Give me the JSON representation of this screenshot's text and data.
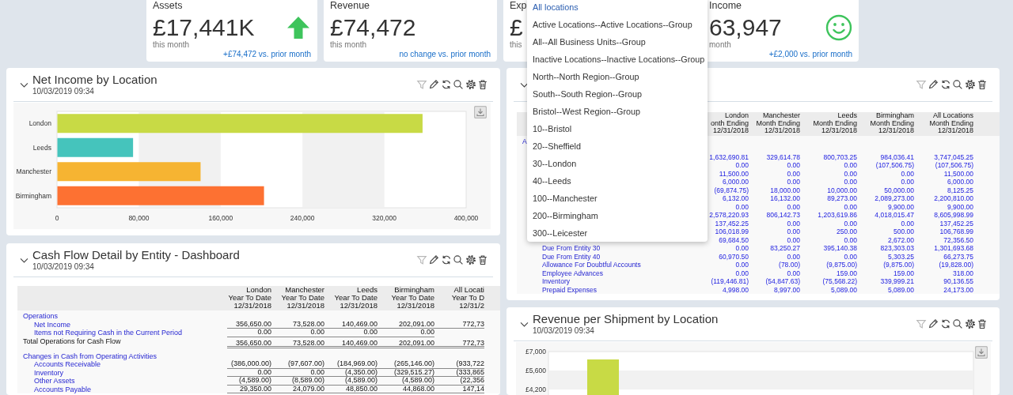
{
  "kpis": [
    {
      "title": "Assets",
      "value": "£17,441K",
      "caption": "this month",
      "change": "+£74,472 vs. prior month",
      "kind": "arrow"
    },
    {
      "title": "Revenue",
      "value": "£74,472",
      "caption": "this month",
      "change": "no change vs. prior month",
      "kind": "plain"
    },
    {
      "title": "Exp",
      "value": "£",
      "caption": "this",
      "kind": "plain"
    },
    {
      "title": "Income",
      "value": "63,947",
      "caption": "month",
      "change": "+£2,000 vs. prior month",
      "kind": "smiley"
    }
  ],
  "location_menu": {
    "items": [
      {
        "label": "All locations",
        "selected": true
      },
      {
        "label": "Active Locations--Active Locations--Group",
        "selected": false
      },
      {
        "label": "All--All Business Units--Group",
        "selected": false
      },
      {
        "label": "Inactive Locations--Inactive Locations--Group",
        "selected": false
      },
      {
        "label": "North--North Region--Group",
        "selected": false
      },
      {
        "label": "South--South Region--Group",
        "selected": false
      },
      {
        "label": "Bristol--West Region--Group",
        "selected": false
      },
      {
        "label": "10--Bristol",
        "selected": false
      },
      {
        "label": "20--Sheffield",
        "selected": false
      },
      {
        "label": "30--London",
        "selected": false
      },
      {
        "label": "40--Leeds",
        "selected": false
      },
      {
        "label": "100--Manchester",
        "selected": false
      },
      {
        "label": "200--Birmingham",
        "selected": false
      },
      {
        "label": "300--Leicester",
        "selected": false
      }
    ]
  },
  "net_income_panel": {
    "title": "Net Income by Location",
    "timestamp": "10/03/2019 09:34",
    "chart_data": {
      "type": "bar",
      "orientation": "horizontal",
      "categories": [
        "London",
        "Leeds",
        "Manchester",
        "Birmingham"
      ],
      "values": [
        357000,
        74000,
        140000,
        202000
      ],
      "colors": [
        "#c8da45",
        "#45c4bc",
        "#f6b432",
        "#fd7132"
      ],
      "xlim": [
        0,
        400000
      ],
      "xticks": [
        {
          "value": 0,
          "label": "0"
        },
        {
          "value": 80000,
          "label": "80,000"
        },
        {
          "value": 160000,
          "label": "160,000"
        },
        {
          "value": 240000,
          "label": "240,000"
        },
        {
          "value": 320000,
          "label": "320,000"
        },
        {
          "value": 400000,
          "label": "400,000"
        }
      ]
    }
  },
  "cash_flow_panel": {
    "title": "Cash Flow Detail by Entity - Dashboard",
    "timestamp": "10/03/2019 09:34",
    "columns": [
      {
        "name": "London",
        "period": "Year To Date",
        "date": "12/31/2018"
      },
      {
        "name": "Manchester",
        "period": "Year To Date",
        "date": "12/31/2018"
      },
      {
        "name": "Leeds",
        "period": "Year To Date",
        "date": "12/31/2018"
      },
      {
        "name": "Birmingham",
        "period": "Year To Date",
        "date": "12/31/2018"
      },
      {
        "name": "All Locati",
        "period": "Year To D",
        "date": "12/31/2"
      }
    ],
    "rows": [
      {
        "kind": "group",
        "label": "Operations"
      },
      {
        "kind": "item",
        "label": "Net Income",
        "values": [
          "356,650.00",
          "73,528.00",
          "140,469.00",
          "202,091.00",
          "772,73"
        ]
      },
      {
        "kind": "item",
        "label": "Items not Requiring Cash in the Current Period",
        "values": [
          "0.00",
          "0.00",
          "0.00",
          "0.00"
        ]
      },
      {
        "kind": "total",
        "label": "Total Operations for Cash Flow",
        "values": [
          "356,650.00",
          "73,528.00",
          "140,469.00",
          "202,091.00",
          "772,73"
        ]
      },
      {
        "kind": "group",
        "label": "Changes in Cash from Operating Activities"
      },
      {
        "kind": "item",
        "label": "Accounts Receivable",
        "values": [
          "(386,000.00)",
          "(97,607.00)",
          "(184,969.00)",
          "(265,146.00)",
          "(933,722"
        ]
      },
      {
        "kind": "item",
        "label": "Inventory",
        "values": [
          "0.00",
          "0.00",
          "(4,350.00)",
          "(329,515.27)",
          "(333,865"
        ]
      },
      {
        "kind": "item",
        "label": "Other Assets",
        "values": [
          "(4,589.00)",
          "(8,589.00)",
          "(4,589.00)",
          "(4,589.00)",
          "(22,356"
        ]
      },
      {
        "kind": "item",
        "label": "Accounts Payable",
        "values": [
          "29,350.00",
          "24,079.00",
          "48,850.00",
          "44,868.00",
          "147,14"
        ]
      }
    ]
  },
  "balance_panel": {
    "columns": [
      {
        "name": "London",
        "period": "onth Ending",
        "date": "12/31/2018"
      },
      {
        "name": "Manchester",
        "period": "Month Ending",
        "date": "12/31/2018"
      },
      {
        "name": "Leeds",
        "period": "Month Ending",
        "date": "12/31/2018"
      },
      {
        "name": "Birmingham",
        "period": "Month Ending",
        "date": "12/31/2018"
      },
      {
        "name": "All Locations",
        "period": "Month Ending",
        "date": "12/31/2018"
      }
    ],
    "rows": [
      {
        "kind": "group",
        "label": "A"
      },
      {
        "kind": "item",
        "values": [
          "1,632,690.81",
          "329,614.78",
          "800,703.25",
          "984,036.41",
          "3,747,045.25"
        ]
      },
      {
        "kind": "item",
        "values": [
          "0.00",
          "0.00",
          "0.00",
          "(107,506.75)",
          "(107,506.75)"
        ]
      },
      {
        "kind": "item",
        "values": [
          "11,500.00",
          "0.00",
          "0.00",
          "0.00",
          "11,500.00"
        ]
      },
      {
        "kind": "item",
        "values": [
          "6,000.00",
          "0.00",
          "0.00",
          "0.00",
          "6,000.00"
        ]
      },
      {
        "kind": "item",
        "values": [
          "(69,874.75)",
          "18,000.00",
          "10,000.00",
          "50,000.00",
          "8,125.25"
        ]
      },
      {
        "kind": "item",
        "values": [
          "6,132.00",
          "16,132.00",
          "89,273.00",
          "2,089,273.00",
          "2,200,810.00"
        ]
      },
      {
        "kind": "item",
        "values": [
          "0.00",
          "0.00",
          "0.00",
          "9,900.00",
          "9,900.00"
        ]
      },
      {
        "kind": "item",
        "values": [
          "2,578,220.93",
          "806,142.73",
          "1,203,619.86",
          "4,018,015.47",
          "8,605,998.99"
        ]
      },
      {
        "kind": "item",
        "values": [
          "137,452.25",
          "0.00",
          "0.00",
          "0.00",
          "137,452.25"
        ]
      },
      {
        "kind": "item",
        "values": [
          "106,018.99",
          "0.00",
          "250.00",
          "500.00",
          "106,768.99"
        ]
      },
      {
        "kind": "item",
        "values": [
          "69,684.50",
          "0.00",
          "0.00",
          "2,672.00",
          "72,356.50"
        ]
      },
      {
        "kind": "item",
        "label": "Due From Entity 30",
        "values": [
          "0.00",
          "83,250.27",
          "395,140.38",
          "823,303.03",
          "1,301,693.68"
        ]
      },
      {
        "kind": "item",
        "label": "Due From Entity 40",
        "values": [
          "60,970.50",
          "0.00",
          "0.00",
          "5,303.25",
          "66,273.75"
        ]
      },
      {
        "kind": "item",
        "label": "Allowance For Doubtful Accounts",
        "values": [
          "0.00",
          "(78.00)",
          "(9,875.00)",
          "(9,875.00)",
          "(19,828.00)"
        ]
      },
      {
        "kind": "item",
        "label": "Employee Advances",
        "values": [
          "0.00",
          "0.00",
          "159.00",
          "159.00",
          "318.00"
        ]
      },
      {
        "kind": "item",
        "label": "Inventory",
        "values": [
          "(119,446.81)",
          "(54,847.63)",
          "(75,568.22)",
          "339,999.21",
          "90,136.55"
        ]
      },
      {
        "kind": "item",
        "label": "Prepaid Expenses",
        "values": [
          "4,998.00",
          "8,997.00",
          "5,089.00",
          "5,089.00",
          "24,173.00"
        ]
      }
    ]
  },
  "revenue_panel": {
    "title": "Revenue per Shipment by Location",
    "timestamp": "10/03/2019 09:34",
    "axis_labels": [
      "£7,000",
      "£5,600",
      "£4,200"
    ]
  }
}
